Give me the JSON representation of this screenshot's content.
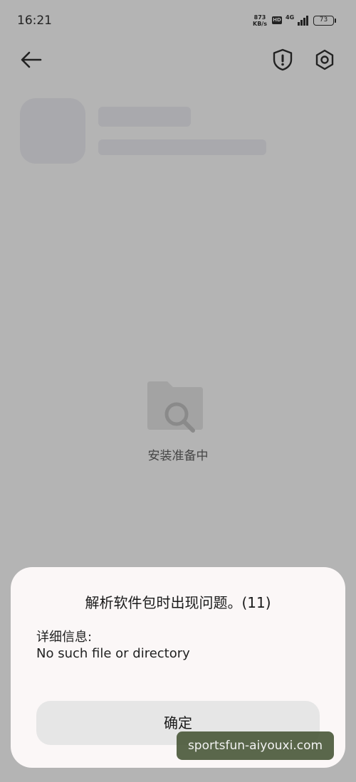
{
  "status_bar": {
    "time": "16:21",
    "net_speed_value": "873",
    "net_speed_unit": "KB/s",
    "hd_label": "HD",
    "network_label": "4G",
    "battery": "73"
  },
  "top_bar": {
    "back_icon": "arrow-left-icon",
    "security_icon": "shield-exclamation-icon",
    "settings_icon": "gear-icon"
  },
  "status": {
    "preparing_text": "安装准备中"
  },
  "dialog": {
    "title": "解析软件包时出现问题。(11)",
    "detail_label": "详细信息:",
    "detail_message": "No such file or directory",
    "ok_label": "确定"
  },
  "watermark": {
    "text": "sportsfun-aiyouxi.com"
  },
  "colors": {
    "background": "#b4b4b4",
    "dialog": "#fbf7f7",
    "button": "#e6e6e6",
    "watermark": "#4c5a3c"
  }
}
